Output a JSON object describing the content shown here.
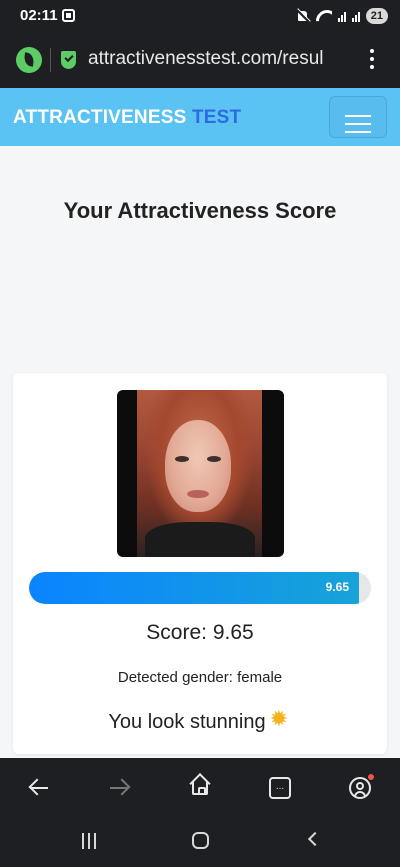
{
  "status_bar": {
    "time": "02:11",
    "battery": "21"
  },
  "browser": {
    "url": "attractivenesstest.com/resul",
    "tabs_glyph": "..."
  },
  "site": {
    "brand_primary": "ATTRACTIVENESS",
    "brand_secondary": "TEST",
    "colors": {
      "header_bg": "#5bc3f3",
      "brand_secondary": "#2b6de0",
      "progress_start": "#0a84ff",
      "progress_end": "#17a3d8"
    }
  },
  "main": {
    "title": "Your Attractiveness Score",
    "result": {
      "progress_label": "9.65",
      "progress_fraction": 0.965,
      "score_text": "Score: 9.65",
      "gender_text": "Detected gender: female",
      "verdict_text": "You look stunning",
      "verdict_icon": "sparkle-star-icon"
    }
  },
  "icons": [
    "leaf-icon",
    "shield-check-icon",
    "kebab-menu-icon",
    "hamburger-menu-icon",
    "back-arrow-icon",
    "forward-arrow-icon",
    "home-icon",
    "tabs-icon",
    "account-icon",
    "sparkle-star-icon"
  ]
}
